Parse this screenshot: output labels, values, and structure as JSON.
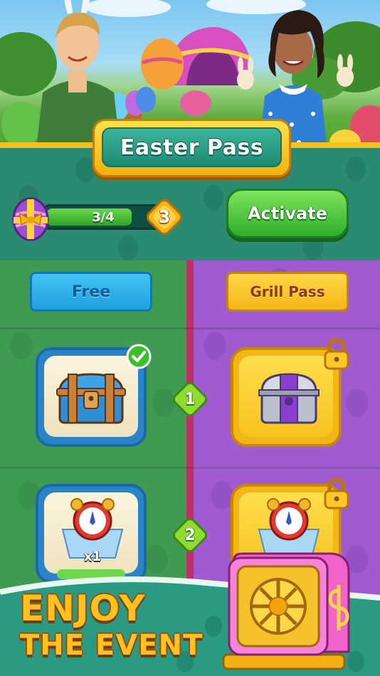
{
  "event": {
    "title": "Easter Pass",
    "progress_text": "3/4",
    "progress_fraction": 0.75,
    "level": "3",
    "activate_label": "Activate"
  },
  "tracks": {
    "free_label": "Free",
    "grill_label": "Grill Pass"
  },
  "rewards": [
    {
      "step": "1",
      "free_item": "chest-blue",
      "free_claimed": true,
      "grill_item": "chest-purple",
      "grill_locked": true
    },
    {
      "step": "2",
      "free_item": "alarm-clock",
      "free_qty": "x1",
      "grill_item": "alarm-clock",
      "grill_locked": true
    }
  ],
  "promo": {
    "line1": "ENJOY",
    "line2": "THE EVENT"
  },
  "colors": {
    "free_column": "#3f9a52",
    "grill_column": "#a05bd0",
    "header_band": "#2a8a72",
    "gold": "#f5c21d",
    "activate_green": "#2fae2c"
  }
}
